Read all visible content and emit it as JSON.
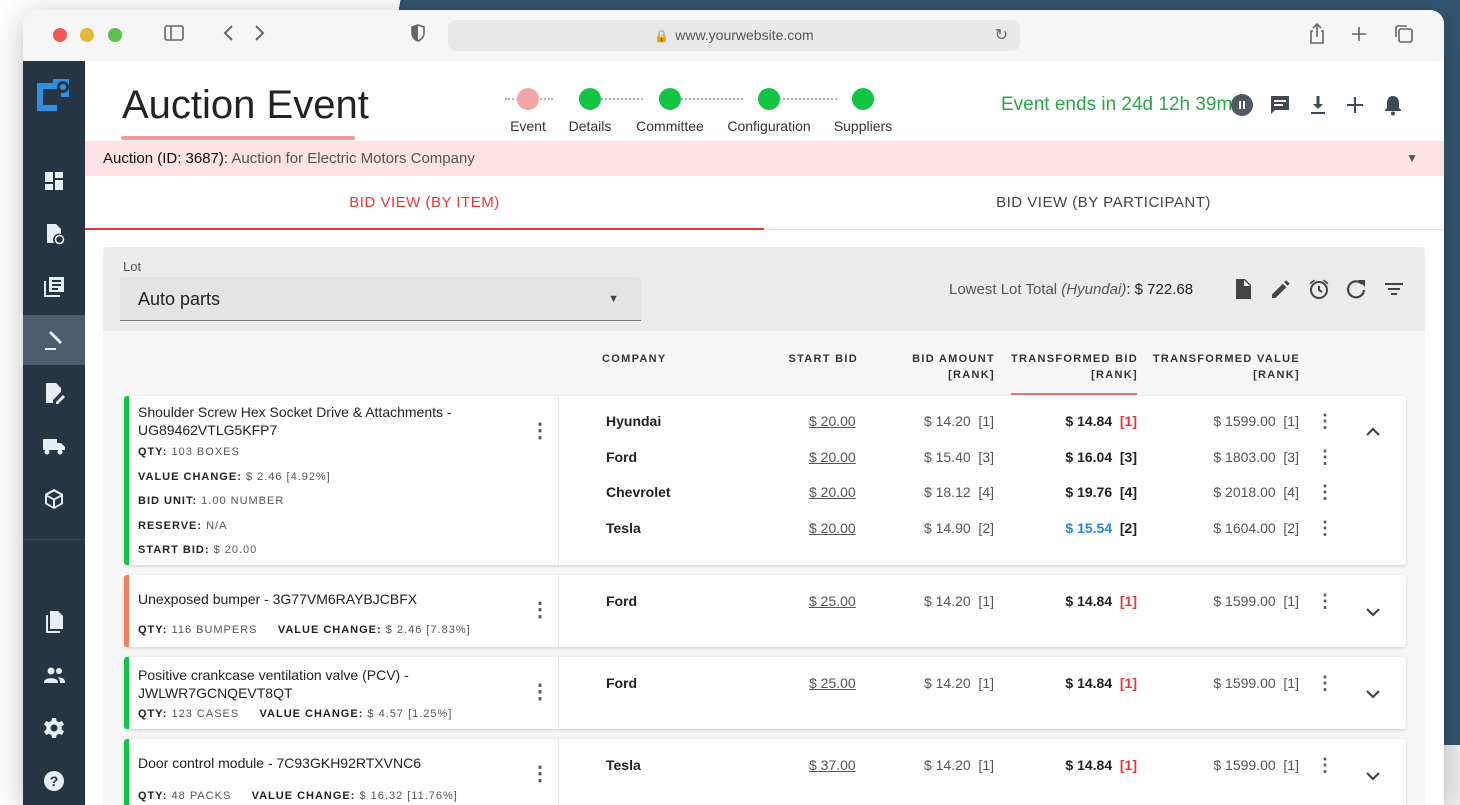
{
  "browser": {
    "url": "www.yourwebsite.com"
  },
  "header": {
    "title": "Auction Event",
    "steps": [
      {
        "label": "Event",
        "state": "current"
      },
      {
        "label": "Details",
        "state": "done"
      },
      {
        "label": "Committee",
        "state": "done"
      },
      {
        "label": "Configuration",
        "state": "done"
      },
      {
        "label": "Suppliers",
        "state": "done"
      }
    ],
    "event_ends": "Event ends in 24d 12h 39m",
    "icons": [
      "pause-icon",
      "chat-icon",
      "download-icon",
      "plus-icon",
      "bell-icon"
    ]
  },
  "auction_bar": {
    "label": "Auction (ID: 3687):",
    "value": "Auction for Electric Motors Company"
  },
  "tabs": [
    {
      "label": "BID VIEW (BY ITEM)",
      "active": true
    },
    {
      "label": "BID VIEW (BY PARTICIPANT)",
      "active": false
    }
  ],
  "lot": {
    "label": "Lot",
    "value": "Auto parts",
    "lowest_prefix": "Lowest Lot Total ",
    "lowest_company": "(Hyundai)",
    "lowest_amount": ": $ 722.68"
  },
  "columns": {
    "company": "COMPANY",
    "start_bid": "START BID",
    "bid_amount": "BID AMOUNT",
    "bid_amount_sub": "[RANK]",
    "transformed_bid": "TRANSFORMED BID",
    "transformed_bid_sub": "[RANK]",
    "transformed_value": "TRANSFORMED VALUE",
    "transformed_value_sub": "[RANK]"
  },
  "items": [
    {
      "title": "Shoulder Screw Hex Socket Drive & Attachments - UG89462VTLG5KFP7",
      "accent": "#11c444",
      "meta": [
        {
          "k": "QTY:",
          "v": " 103 BOXES"
        },
        {
          "k": "VALUE CHANGE:",
          "v": " $ 2.46 [4.92%]"
        },
        {
          "k": "BID UNIT:",
          "v": " 1.00 NUMBER"
        },
        {
          "k": "RESERVE:",
          "v": " N/A"
        },
        {
          "k": "START BID:",
          "v": " $ 20.00"
        }
      ],
      "rows": [
        {
          "company": "Hyundai",
          "start": "$ 20.00",
          "bid": "$ 14.20  [1]",
          "tbid": "$ 14.84",
          "trank": "[1]",
          "trank_red": true,
          "blue": false,
          "tval": "$ 1599.00  [1]"
        },
        {
          "company": "Ford",
          "start": "$ 20.00",
          "bid": "$ 15.40  [3]",
          "tbid": "$ 16.04",
          "trank": "[3]",
          "trank_red": false,
          "blue": false,
          "tval": "$ 1803.00  [3]"
        },
        {
          "company": "Chevrolet",
          "start": "$ 20.00",
          "bid": "$ 18.12  [4]",
          "tbid": "$ 19.76",
          "trank": "[4]",
          "trank_red": false,
          "blue": false,
          "tval": "$ 2018.00  [4]"
        },
        {
          "company": "Tesla",
          "start": "$ 20.00",
          "bid": "$ 14.90  [2]",
          "tbid": "$ 15.54",
          "trank": "[2]",
          "trank_red": false,
          "blue": true,
          "tval": "$ 1604.00  [2]"
        }
      ]
    },
    {
      "title": "Unexposed bumper - 3G77VM6RAYBJCBFX",
      "accent": "#f0805a",
      "meta_line": {
        "k1": "QTY:",
        "v1": " 116 BUMPERS",
        "k2": "VALUE CHANGE:",
        "v2": " $ 2.46 [7.83%]"
      },
      "rows": [
        {
          "company": "Ford",
          "start": "$ 25.00",
          "bid": "$ 14.20  [1]",
          "tbid": "$ 14.84",
          "trank": "[1]",
          "trank_red": true,
          "blue": false,
          "tval": "$ 1599.00  [1]"
        }
      ]
    },
    {
      "title": "Positive crankcase ventilation valve (PCV) - JWLWR7GCNQEVT8QT",
      "accent": "#11c444",
      "meta_line": {
        "k1": "QTY:",
        "v1": " 123 CASES",
        "k2": "VALUE CHANGE:",
        "v2": " $ 4.57 [1.25%]"
      },
      "rows": [
        {
          "company": "Ford",
          "start": "$ 25.00",
          "bid": "$ 14.20  [1]",
          "tbid": "$ 14.84",
          "trank": "[1]",
          "trank_red": true,
          "blue": false,
          "tval": "$ 1599.00  [1]"
        }
      ]
    },
    {
      "title": "Door control module - 7C93GKH92RTXVNC6",
      "accent": "#11c444",
      "meta_line": {
        "k1": "QTY:",
        "v1": " 48 PACKS",
        "k2": "VALUE CHANGE:",
        "v2": " $ 16.32 [11.76%]"
      },
      "rows": [
        {
          "company": "Tesla",
          "start": "$ 37.00",
          "bid": "$ 14.20  [1]",
          "tbid": "$ 14.84",
          "trank": "[1]",
          "trank_red": true,
          "blue": false,
          "tval": "$ 1599.00  [1]"
        }
      ]
    }
  ]
}
